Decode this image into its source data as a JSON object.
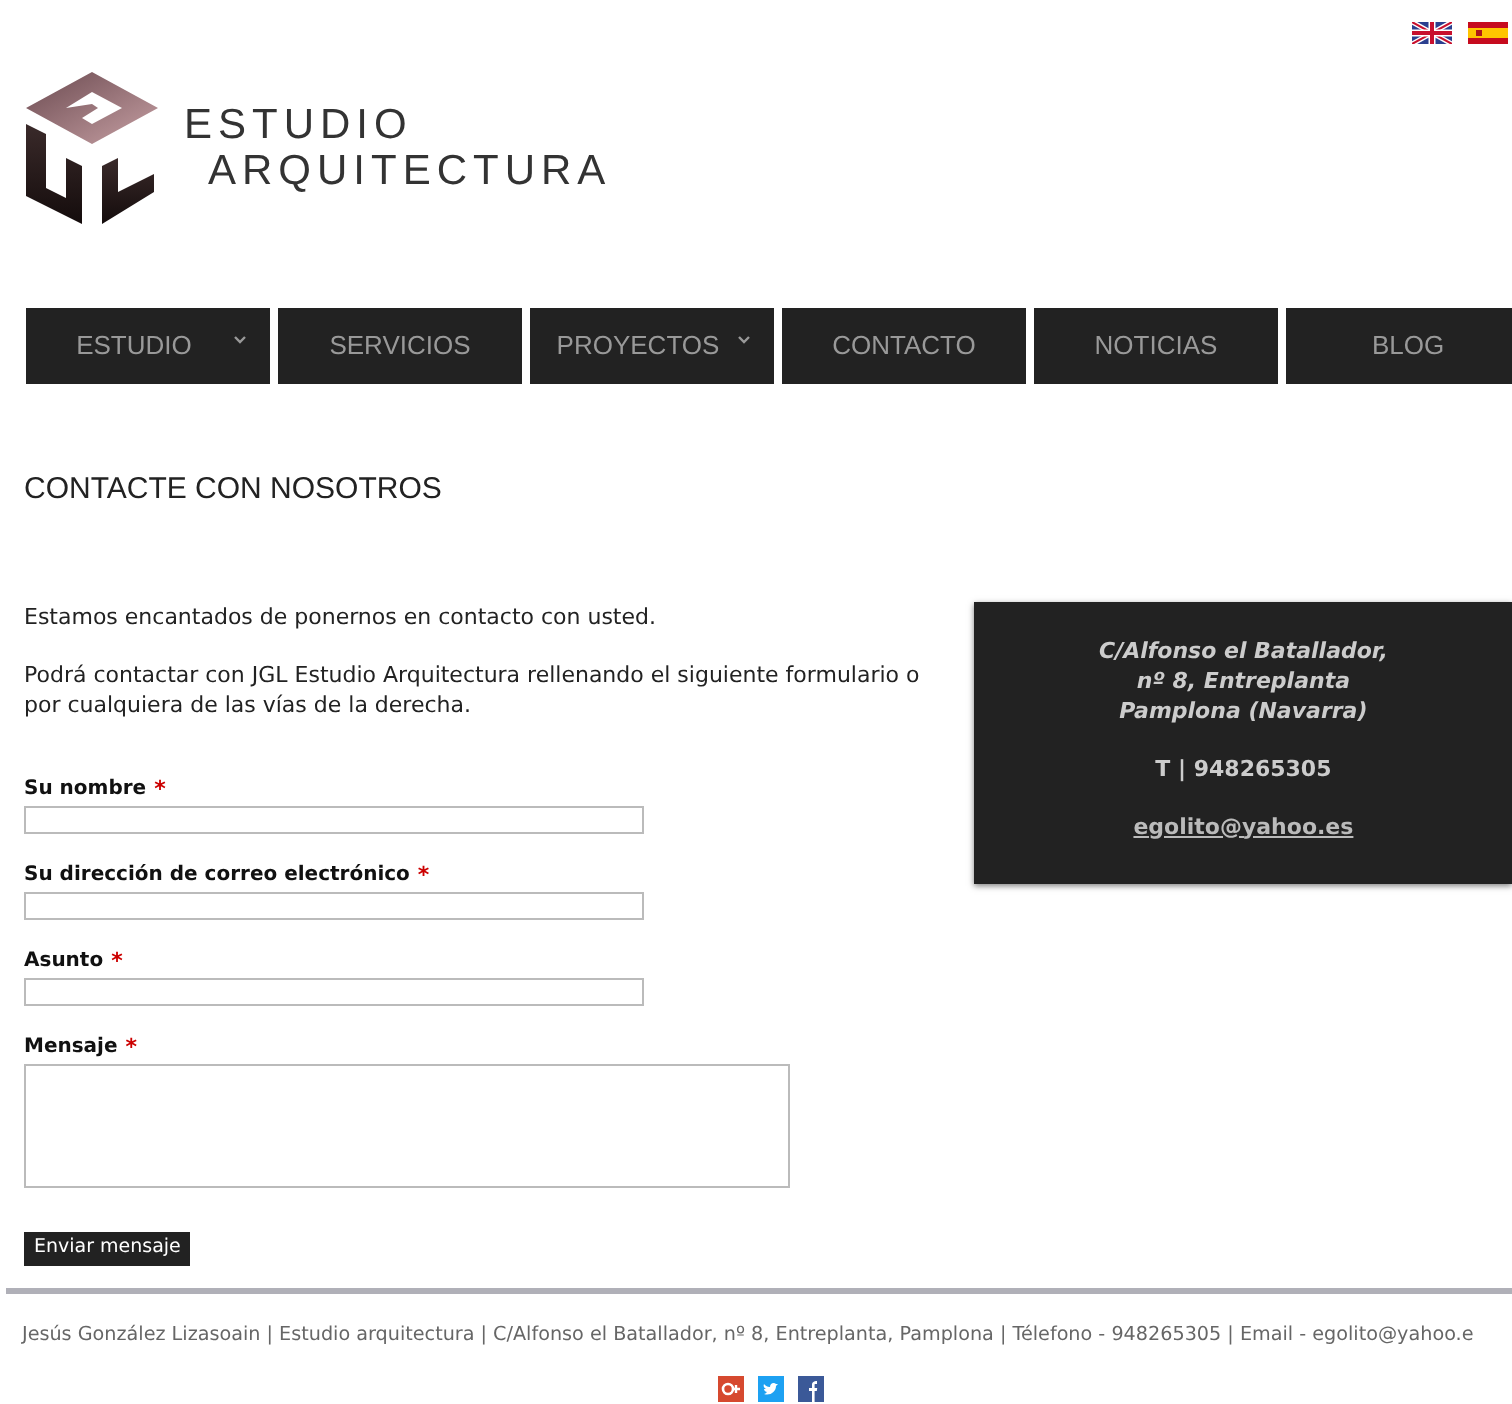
{
  "logo": {
    "line_1": "ESTUDIO",
    "line_2": "ARQUITECTURA"
  },
  "menu": [
    {
      "label": "ESTUDIO",
      "has_submenu": true
    },
    {
      "label": "SERVICIOS",
      "has_submenu": false
    },
    {
      "label": "PROYECTOS",
      "has_submenu": true
    },
    {
      "label": "CONTACTO",
      "has_submenu": false
    },
    {
      "label": "NOTICIAS",
      "has_submenu": false
    },
    {
      "label": "BLOG",
      "has_submenu": false
    }
  ],
  "page_title": "CONTACTE CON NOSOTROS",
  "intro": [
    "Estamos encantados de ponernos en contacto con usted.",
    "Podrá contactar con JGL Estudio Arquitectura rellenando el siguiente formulario o por cualquiera de las vías de la derecha."
  ],
  "form": {
    "fields": [
      {
        "label": "Su nombre",
        "required_mark": "*",
        "kind": "text"
      },
      {
        "label": "Su dirección de correo electrónico",
        "required_mark": "*",
        "kind": "text"
      },
      {
        "label": "Asunto",
        "required_mark": "*",
        "kind": "text"
      },
      {
        "label": "Mensaje",
        "required_mark": "*",
        "kind": "textarea"
      }
    ],
    "submit": "Enviar mensaje"
  },
  "contact_card": {
    "address": [
      "C/Alfonso el Batallador,",
      "nº 8, Entreplanta",
      "Pamplona (Navarra)"
    ],
    "phone": "T | 948265305",
    "email": "egolito@yahoo.es"
  },
  "footer": {
    "text": "Jesús González Lizasoain | Estudio arquitectura | C/Alfonso el Batallador, nº 8, Entreplanta, Pamplona | Télefono - 948265305 | Email - egolito@yahoo.e"
  }
}
